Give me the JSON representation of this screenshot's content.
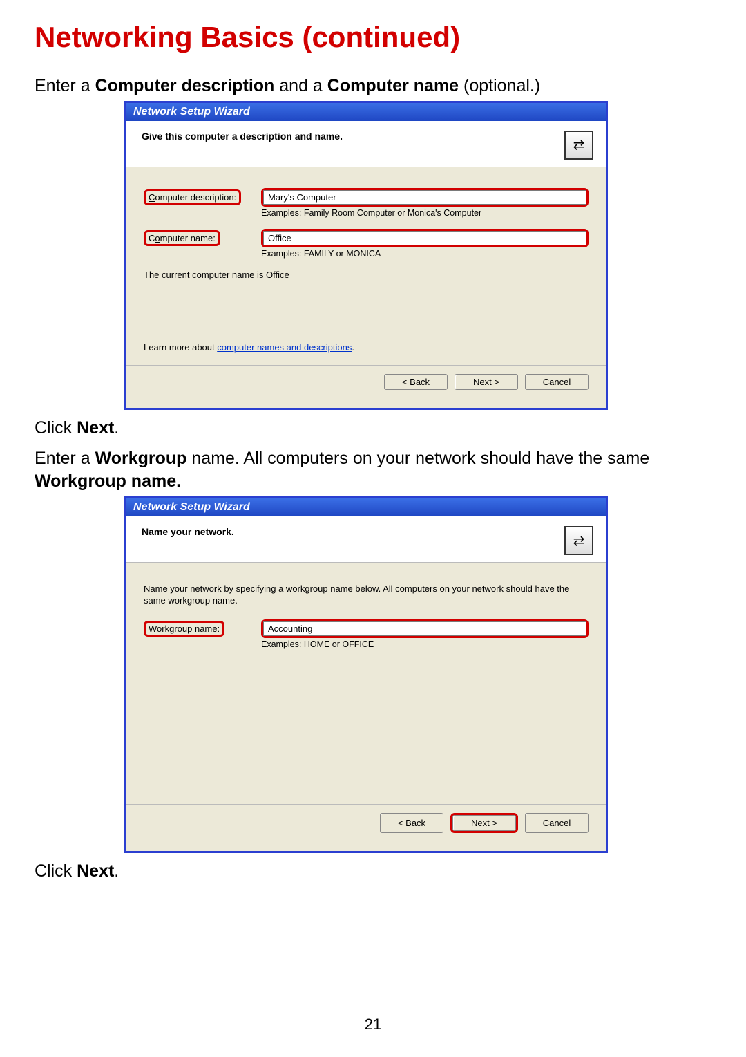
{
  "page": {
    "title": "Networking Basics (continued)",
    "number": "21"
  },
  "instructions": {
    "line1_pre": "Enter a ",
    "line1_b1": "Computer description",
    "line1_mid": " and a ",
    "line1_b2": "Computer name",
    "line1_post": " (optional.)",
    "click_next_pre": "Click ",
    "click_next_bold": "Next",
    "click_next_post": ".",
    "line3_pre": "Enter a ",
    "line3_b1": "Workgroup",
    "line3_mid": " name.  All computers on your network should have the same ",
    "line3_b2": "Workgroup name.",
    "click_next2_pre": "Click ",
    "click_next2_bold": "Next",
    "click_next2_post": "."
  },
  "dialog1": {
    "title": "Network Setup Wizard",
    "header": "Give this computer a description and name.",
    "icon_glyph": "⇄",
    "desc_label_u": "C",
    "desc_label_rest": "omputer description:",
    "desc_value": "Mary's Computer",
    "desc_example": "Examples: Family Room Computer or Monica's Computer",
    "name_label_pre": "C",
    "name_label_u": "o",
    "name_label_rest": "mputer name:",
    "name_value": "Office",
    "name_example": "Examples: FAMILY or MONICA",
    "current_name": "The current computer name is Office",
    "learn_pre": "Learn more about ",
    "learn_link": "computer names and descriptions",
    "learn_post": ".",
    "back_lt": "< ",
    "back_u": "B",
    "back_rest": "ack",
    "next_u": "N",
    "next_rest": "ext >",
    "cancel": "Cancel"
  },
  "dialog2": {
    "title": "Network Setup Wizard",
    "header": "Name your network.",
    "icon_glyph": "⇄",
    "intro": "Name your network by specifying a workgroup name below. All computers on your network should have the same workgroup name.",
    "wg_label_u": "W",
    "wg_label_rest": "orkgroup name:",
    "wg_value": "Accounting",
    "wg_example": "Examples: HOME or OFFICE",
    "back_lt": "< ",
    "back_u": "B",
    "back_rest": "ack",
    "next_u": "N",
    "next_rest": "ext >",
    "cancel": "Cancel"
  }
}
